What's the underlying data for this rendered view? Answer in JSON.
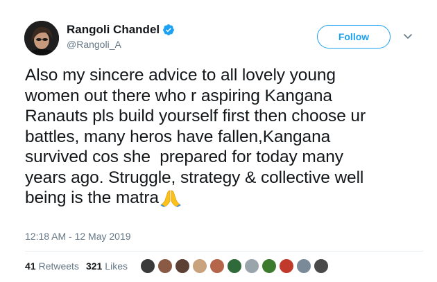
{
  "author": {
    "name": "Rangoli Chandel",
    "handle": "@Rangoli_A",
    "verified": true
  },
  "follow_button": {
    "label": "Follow"
  },
  "tweet": {
    "lines": [
      "Also my sincere advice to all lovely young",
      "women out there who r aspiring Kangana",
      "Ranauts pls build yourself first then choose ur",
      "battles, many heros have fallen,Kangana",
      "survived cos she  prepared for today many",
      "years ago. Struggle, strategy & collective well",
      "being is the matra"
    ],
    "emoji": "folded-hands-icon"
  },
  "timestamp": "12:18 AM - 12 May 2019",
  "stats": {
    "retweets_count": "41",
    "retweets_label": "Retweets",
    "likes_count": "321",
    "likes_label": "Likes"
  },
  "colors": {
    "accent": "#1da1f2",
    "secondary_text": "#657786",
    "primary_text": "#14171a"
  },
  "liker_avatars": [
    {
      "color": "#3a3a3a"
    },
    {
      "color": "#8a5a44"
    },
    {
      "color": "#5c4033"
    },
    {
      "color": "#c9a27e"
    },
    {
      "color": "#b5654a"
    },
    {
      "color": "#2f6b3a"
    },
    {
      "color": "#9aa4ab"
    },
    {
      "color": "#3c7a2e"
    },
    {
      "color": "#c0392b"
    },
    {
      "color": "#7a8a99"
    },
    {
      "color": "#4a4a4a"
    }
  ]
}
